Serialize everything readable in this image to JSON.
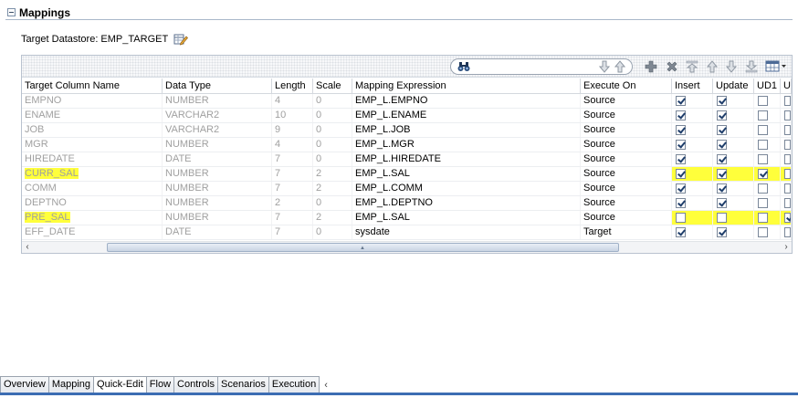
{
  "section": {
    "title": "Mappings"
  },
  "datastore": {
    "label": "Target Datastore: EMP_TARGET"
  },
  "search": {
    "value": ""
  },
  "columns": [
    "Target Column Name",
    "Data Type",
    "Length",
    "Scale",
    "Mapping Expression",
    "Execute On",
    "Insert",
    "Update",
    "UD1",
    "UI"
  ],
  "rows": [
    {
      "name": "EMPNO",
      "type": "NUMBER",
      "length": "4",
      "scale": "0",
      "expr": "EMP_L.EMPNO",
      "exec": "Source",
      "insert": true,
      "update": true,
      "ud1": false,
      "ud2": false,
      "hl": false
    },
    {
      "name": "ENAME",
      "type": "VARCHAR2",
      "length": "10",
      "scale": "0",
      "expr": "EMP_L.ENAME",
      "exec": "Source",
      "insert": true,
      "update": true,
      "ud1": false,
      "ud2": false,
      "hl": false
    },
    {
      "name": "JOB",
      "type": "VARCHAR2",
      "length": "9",
      "scale": "0",
      "expr": "EMP_L.JOB",
      "exec": "Source",
      "insert": true,
      "update": true,
      "ud1": false,
      "ud2": false,
      "hl": false
    },
    {
      "name": "MGR",
      "type": "NUMBER",
      "length": "4",
      "scale": "0",
      "expr": "EMP_L.MGR",
      "exec": "Source",
      "insert": true,
      "update": true,
      "ud1": false,
      "ud2": false,
      "hl": false
    },
    {
      "name": "HIREDATE",
      "type": "DATE",
      "length": "7",
      "scale": "0",
      "expr": "EMP_L.HIREDATE",
      "exec": "Source",
      "insert": true,
      "update": true,
      "ud1": false,
      "ud2": false,
      "hl": false
    },
    {
      "name": "CURR_SAL",
      "type": "NUMBER",
      "length": "7",
      "scale": "2",
      "expr": "EMP_L.SAL",
      "exec": "Source",
      "insert": true,
      "update": true,
      "ud1": true,
      "ud2": false,
      "hl": true
    },
    {
      "name": "COMM",
      "type": "NUMBER",
      "length": "7",
      "scale": "2",
      "expr": "EMP_L.COMM",
      "exec": "Source",
      "insert": true,
      "update": true,
      "ud1": false,
      "ud2": false,
      "hl": false
    },
    {
      "name": "DEPTNO",
      "type": "NUMBER",
      "length": "2",
      "scale": "0",
      "expr": "EMP_L.DEPTNO",
      "exec": "Source",
      "insert": true,
      "update": true,
      "ud1": false,
      "ud2": false,
      "hl": false
    },
    {
      "name": "PRE_SAL",
      "type": "NUMBER",
      "length": "7",
      "scale": "2",
      "expr": "EMP_L.SAL",
      "exec": "Source",
      "insert": false,
      "update": false,
      "ud1": false,
      "ud2": true,
      "hl": true
    },
    {
      "name": "EFF_DATE",
      "type": "DATE",
      "length": "7",
      "scale": "0",
      "expr": "sysdate",
      "exec": "Target",
      "insert": true,
      "update": true,
      "ud1": false,
      "ud2": false,
      "hl": false
    }
  ],
  "tabs": [
    {
      "label": "Overview",
      "active": false
    },
    {
      "label": "Mapping",
      "active": false
    },
    {
      "label": "Quick-Edit",
      "active": true
    },
    {
      "label": "Flow",
      "active": false
    },
    {
      "label": "Controls",
      "active": false
    },
    {
      "label": "Scenarios",
      "active": false
    },
    {
      "label": "Execution",
      "active": false
    }
  ],
  "colors": {
    "highlight": "#ffff3b",
    "tab_underline": "#3c6db3",
    "check": "#1f3e6b"
  },
  "icons": {
    "collapse": "minus-box-icon",
    "edit": "edit-table-icon",
    "search": "binoculars-icon",
    "toolbar": [
      "add-icon",
      "delete-icon",
      "move-top-icon",
      "move-up-icon",
      "move-down-icon",
      "move-bottom-icon",
      "column-chooser-icon"
    ]
  }
}
